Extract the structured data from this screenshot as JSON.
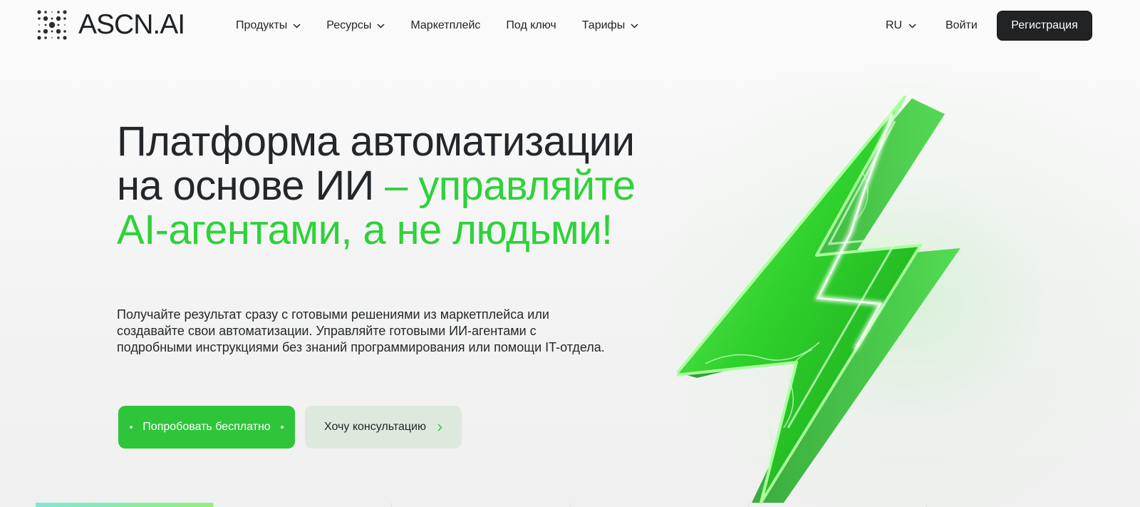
{
  "header": {
    "logo_text": "ASCN.AI",
    "logo_icon": "dotted-x-logo-icon",
    "nav": [
      {
        "label": "Продукты",
        "has_dropdown": true
      },
      {
        "label": "Ресурсы",
        "has_dropdown": true
      },
      {
        "label": "Маркетплейс",
        "has_dropdown": false
      },
      {
        "label": "Под ключ",
        "has_dropdown": false
      },
      {
        "label": "Тарифы",
        "has_dropdown": true
      }
    ],
    "language": "RU",
    "login_label": "Войти",
    "register_label": "Регистрация"
  },
  "hero": {
    "title_dark": "Платформа автоматизации на основе ИИ",
    "title_accent": " – управляйте AI-агентами, а не людьми!",
    "subtitle": "Получайте результат сразу с готовыми решениями из маркетплейса или создавайте свои автоматизации. Управляйте готовыми ИИ-агентами с подробными инструкциями без знаний программирования или помощи IT-отдела.",
    "primary_button": "Попробовать бесплатно",
    "secondary_button": "Хочу консультацию",
    "illustration": "green-lightning-bolt"
  },
  "tabs": {
    "count": 6,
    "active_index": 0
  },
  "colors": {
    "accent": "#2ed23a",
    "button_primary": "#2ec53a",
    "button_secondary": "#dde9dd",
    "register_bg": "#212325",
    "text": "#23272b"
  }
}
